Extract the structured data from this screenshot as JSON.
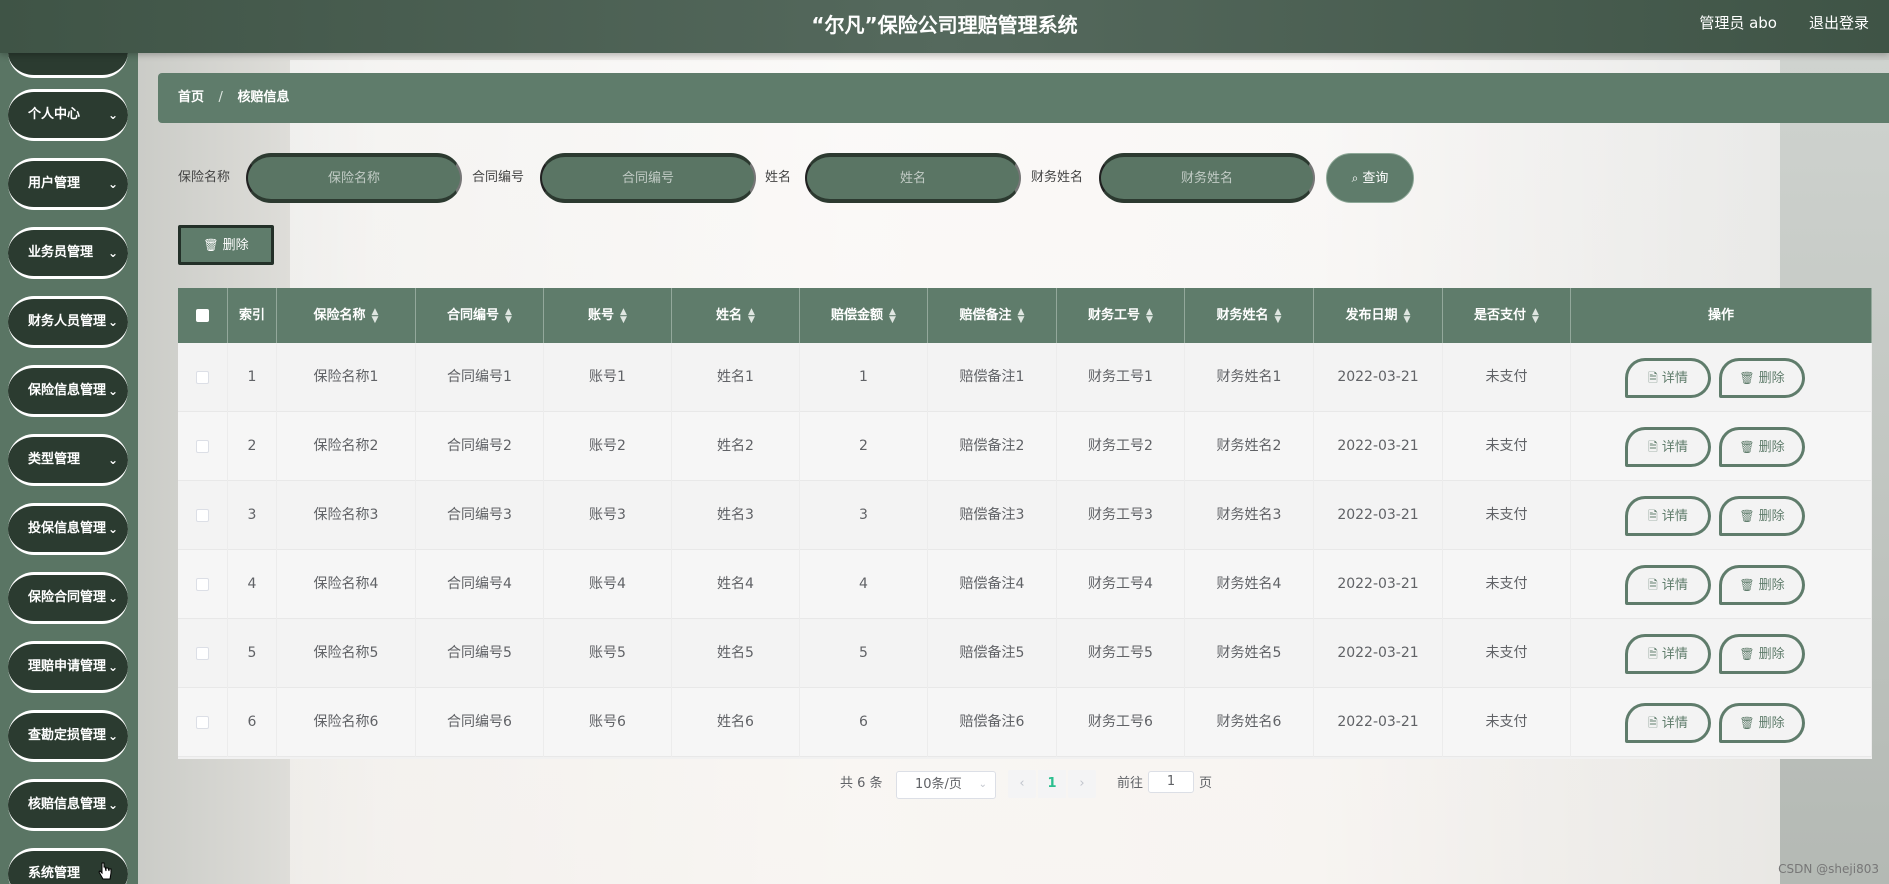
{
  "header": {
    "title": "“尔凡”保险公司理赔管理系统",
    "user": "管理员 abo",
    "logout": "退出登录"
  },
  "sidebar": {
    "items": [
      {
        "label": "",
        "chevron": false
      },
      {
        "label": "个人中心",
        "chevron": true
      },
      {
        "label": "用户管理",
        "chevron": true
      },
      {
        "label": "业务员管理",
        "chevron": true
      },
      {
        "label": "财务人员管理",
        "chevron": true
      },
      {
        "label": "保险信息管理",
        "chevron": true
      },
      {
        "label": "类型管理",
        "chevron": true
      },
      {
        "label": "投保信息管理",
        "chevron": true
      },
      {
        "label": "保险合同管理",
        "chevron": true
      },
      {
        "label": "理赔申请管理",
        "chevron": true
      },
      {
        "label": "查勘定损管理",
        "chevron": true
      },
      {
        "label": "核赔信息管理",
        "chevron": true
      },
      {
        "label": "系统管理",
        "chevron": false
      }
    ]
  },
  "breadcrumb": {
    "home": "首页",
    "separator": "/",
    "current": "核赔信息"
  },
  "search": {
    "fields": [
      {
        "label": "保险名称",
        "placeholder": "保险名称",
        "value": ""
      },
      {
        "label": "合同编号",
        "placeholder": "合同编号",
        "value": ""
      },
      {
        "label": "姓名",
        "placeholder": "姓名",
        "value": ""
      },
      {
        "label": "财务姓名",
        "placeholder": "财务姓名",
        "value": ""
      }
    ],
    "button": "查询"
  },
  "toolbar": {
    "delete_label": "删除"
  },
  "table": {
    "columns": [
      "索引",
      "保险名称",
      "合同编号",
      "账号",
      "姓名",
      "赔偿金额",
      "赔偿备注",
      "财务工号",
      "财务姓名",
      "发布日期",
      "是否支付",
      "操作"
    ],
    "rows": [
      [
        "1",
        "保险名称1",
        "合同编号1",
        "账号1",
        "姓名1",
        "1",
        "赔偿备注1",
        "财务工号1",
        "财务姓名1",
        "2022-03-21",
        "未支付"
      ],
      [
        "2",
        "保险名称2",
        "合同编号2",
        "账号2",
        "姓名2",
        "2",
        "赔偿备注2",
        "财务工号2",
        "财务姓名2",
        "2022-03-21",
        "未支付"
      ],
      [
        "3",
        "保险名称3",
        "合同编号3",
        "账号3",
        "姓名3",
        "3",
        "赔偿备注3",
        "财务工号3",
        "财务姓名3",
        "2022-03-21",
        "未支付"
      ],
      [
        "4",
        "保险名称4",
        "合同编号4",
        "账号4",
        "姓名4",
        "4",
        "赔偿备注4",
        "财务工号4",
        "财务姓名4",
        "2022-03-21",
        "未支付"
      ],
      [
        "5",
        "保险名称5",
        "合同编号5",
        "账号5",
        "姓名5",
        "5",
        "赔偿备注5",
        "财务工号5",
        "财务姓名5",
        "2022-03-21",
        "未支付"
      ],
      [
        "6",
        "保险名称6",
        "合同编号6",
        "账号6",
        "姓名6",
        "6",
        "赔偿备注6",
        "财务工号6",
        "财务姓名6",
        "2022-03-21",
        "未支付"
      ]
    ],
    "detail_label": "详情",
    "delete_label": "删除"
  },
  "pagination": {
    "total": "共 6 条",
    "page_size": "10条/页",
    "current_page": "1",
    "goto_prefix": "前往",
    "goto_value": "1",
    "goto_suffix": "页"
  },
  "watermark": "CSDN @sheji803",
  "colors": {
    "primary": "#5f7c6b",
    "dark": "#2b3b30",
    "active_page": "#2bbf8f"
  }
}
